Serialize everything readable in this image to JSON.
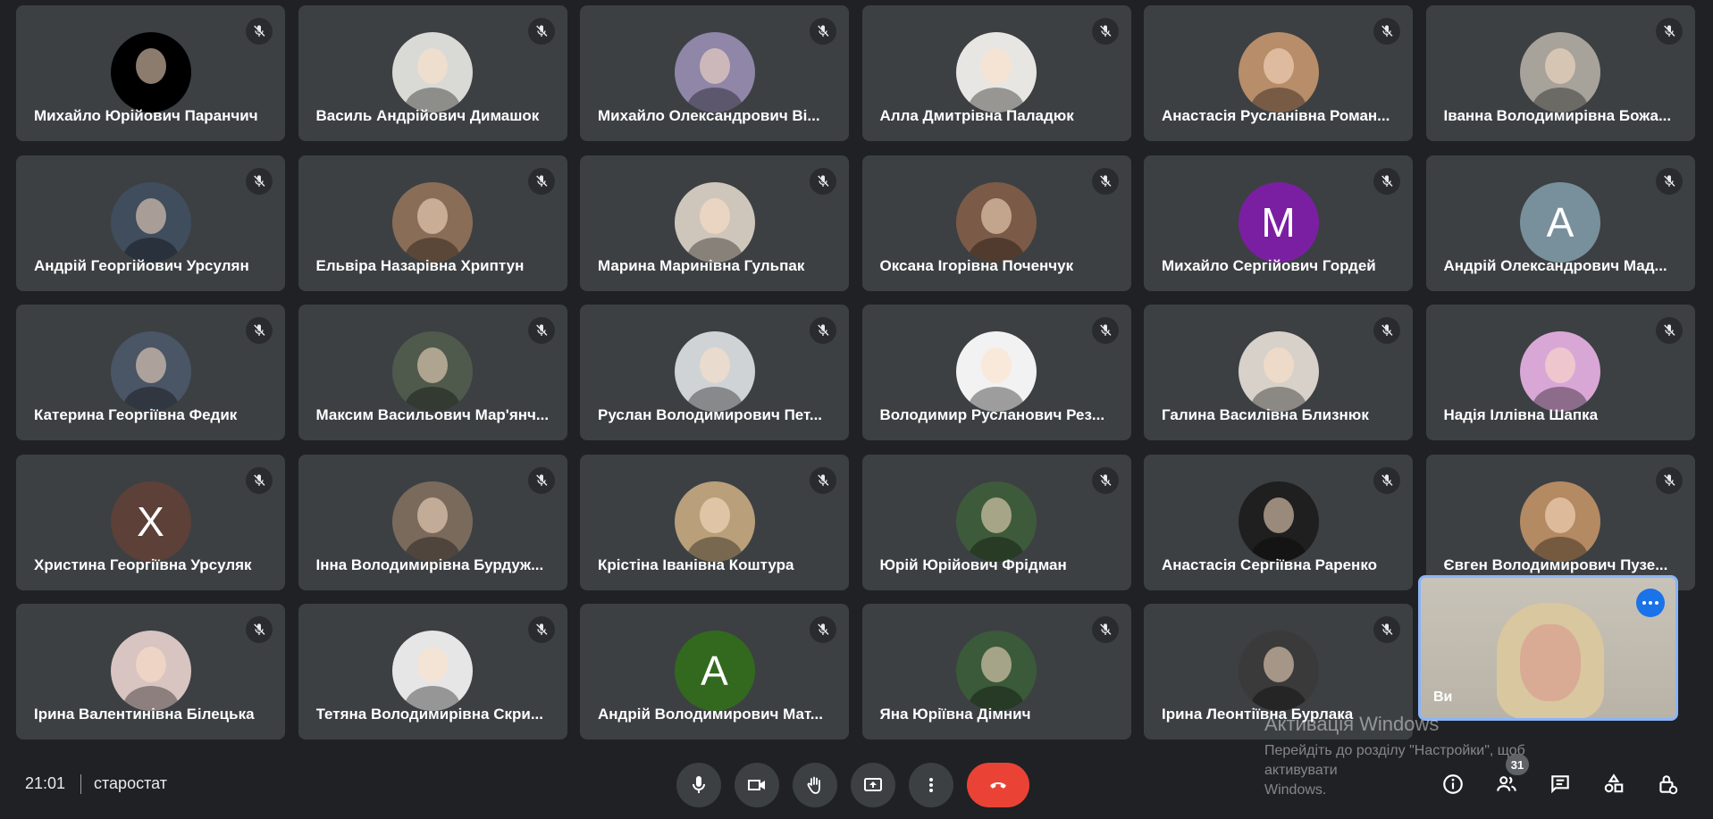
{
  "participants": [
    {
      "name": "Михайло Юрійович Парaнчич",
      "avatar": "photo",
      "bg": "#000000"
    },
    {
      "name": "Василь Андрійович Димашок",
      "avatar": "photo",
      "bg": "#d9d9d5"
    },
    {
      "name": "Михайло Олександрович Ві...",
      "avatar": "photo",
      "bg": "#8f86a8"
    },
    {
      "name": "Алла Дмитрівна Паладюк",
      "avatar": "photo",
      "bg": "#e8e6e2"
    },
    {
      "name": "Анастасія Русланівна Роман...",
      "avatar": "photo",
      "bg": "#b78d6a"
    },
    {
      "name": "Іванна Володимирівна Божа...",
      "avatar": "photo",
      "bg": "#a7a39b"
    },
    {
      "name": "Андрій Георгійович Урсулян",
      "avatar": "photo",
      "bg": "#3f4d5c"
    },
    {
      "name": "Ельвіра Назарівна Хриптун",
      "avatar": "photo",
      "bg": "#8a6d57"
    },
    {
      "name": "Марина Маринівна Гульпак",
      "avatar": "photo",
      "bg": "#cfc6bb"
    },
    {
      "name": "Оксана Ігорівна Поченчук",
      "avatar": "photo",
      "bg": "#7b5b47"
    },
    {
      "name": "Михайло Сергійович Гордей",
      "avatar": "letter",
      "letter": "M",
      "bg": "#7b1fa2"
    },
    {
      "name": "Андрій Олександрович Мад...",
      "avatar": "letter",
      "letter": "A",
      "bg": "#78909c"
    },
    {
      "name": "Катерина Георгіївна Федик",
      "avatar": "photo",
      "bg": "#4a5565"
    },
    {
      "name": "Максим Васильович Мар'янч...",
      "avatar": "photo",
      "bg": "#4f5a4c"
    },
    {
      "name": "Руслан Володимирович Пет...",
      "avatar": "photo",
      "bg": "#cfd3d6"
    },
    {
      "name": "Володимир Русланович Рез...",
      "avatar": "photo",
      "bg": "#f2f2f2"
    },
    {
      "name": "Галина Василівна Близнюк",
      "avatar": "photo",
      "bg": "#d7d1c9"
    },
    {
      "name": "Надія Іллівна Шапка",
      "avatar": "photo",
      "bg": "#d9a7d6"
    },
    {
      "name": "Христина Георгіївна Урсуляк",
      "avatar": "letter",
      "letter": "X",
      "bg": "#5d4037"
    },
    {
      "name": "Інна Володимирівна Бурдуж...",
      "avatar": "photo",
      "bg": "#7a6a5c"
    },
    {
      "name": "Крістіна Іванівна Коштура",
      "avatar": "photo",
      "bg": "#b9a07a"
    },
    {
      "name": "Юрій Юрійович Фрідман",
      "avatar": "photo",
      "bg": "#3d5b3a"
    },
    {
      "name": "Анастасія Сергіївна Раренко",
      "avatar": "photo",
      "bg": "#1f1f1f"
    },
    {
      "name": "Євген Володимирович Пузе...",
      "avatar": "photo",
      "bg": "#b48a63"
    },
    {
      "name": "Ірина Валентинівна Білецька",
      "avatar": "photo",
      "bg": "#d8c4c0"
    },
    {
      "name": "Тетяна Володимирівна Скри...",
      "avatar": "photo",
      "bg": "#e6e6e6"
    },
    {
      "name": "Андрій Володимирович Мат...",
      "avatar": "letter",
      "letter": "A",
      "bg": "#33691e"
    },
    {
      "name": "Яна Юріївна Дімнич",
      "avatar": "photo",
      "bg": "#3b5a3a"
    },
    {
      "name": "Ірина Леонтіївна Бурлака",
      "avatar": "photo",
      "bg": "#3a3a3a"
    }
  ],
  "self_view": {
    "label": "Ви"
  },
  "watermark": {
    "title": "Активація Windows",
    "line1": "Перейдіть до розділу \"Настройки\", щоб активувати",
    "line2": "Windows."
  },
  "bottom_bar": {
    "time": "21:01",
    "meeting_name": "старостат",
    "people_count": "31"
  },
  "colors": {
    "background": "#202124",
    "tile": "#3c4043",
    "end_call": "#ea4335",
    "self_border": "#8ab4f8",
    "accent": "#1a73e8"
  },
  "icons": {
    "tile_status": "mic-off-icon",
    "controls": [
      "mic-icon",
      "camera-icon",
      "raise-hand-icon",
      "present-screen-icon",
      "more-options-icon",
      "end-call-icon"
    ],
    "right": [
      "info-icon",
      "people-icon",
      "chat-icon",
      "activities-icon",
      "host-controls-icon"
    ]
  }
}
